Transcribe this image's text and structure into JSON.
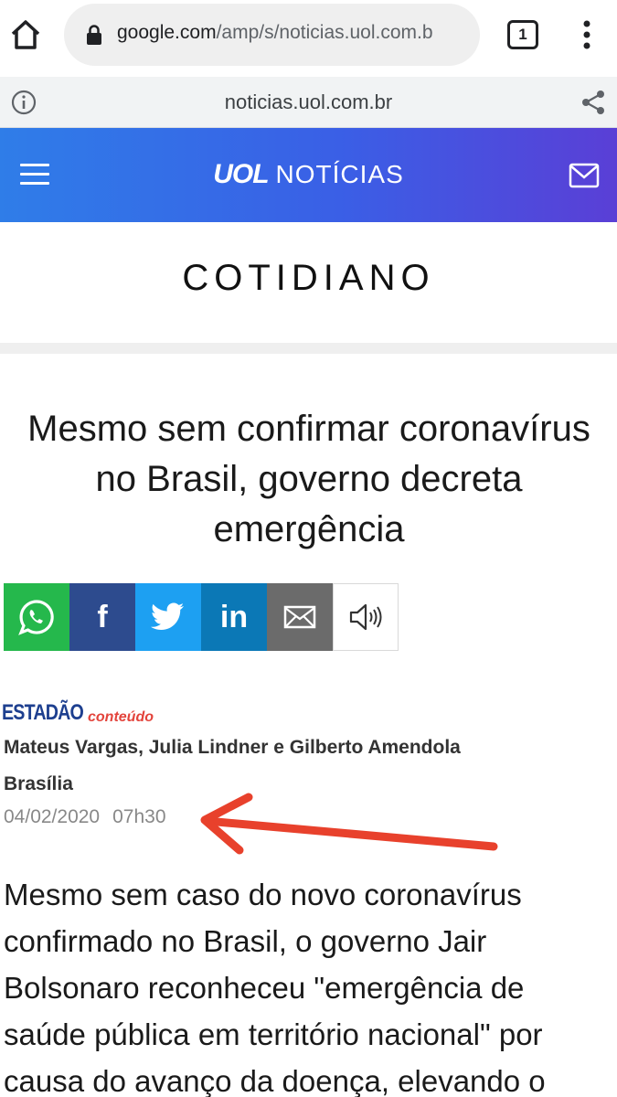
{
  "browser": {
    "url_host": "google.com",
    "url_path": "/amp/s/noticias.uol.com.b",
    "tab_count": "1",
    "icons": [
      "home-icon",
      "lock-icon",
      "overflow-menu-icon"
    ]
  },
  "amp_bar": {
    "domain": "noticias.uol.com.br",
    "icons": [
      "info-icon",
      "share-icon"
    ]
  },
  "header": {
    "logo": "UOL",
    "section": "NOTÍCIAS",
    "gradient": [
      "#2f7de8",
      "#5a3fd6"
    ],
    "icons": [
      "hamburger-menu-icon",
      "mail-icon"
    ]
  },
  "section_title": "COTIDIANO",
  "article": {
    "headline": "Mesmo sem confirmar coronavírus no Brasil, governo decreta emergência",
    "share_buttons": [
      {
        "name": "whatsapp",
        "icon": "whatsapp-icon",
        "color": "#25b84c"
      },
      {
        "name": "facebook",
        "icon": "facebook-icon",
        "label": "f",
        "color": "#2d4b8e"
      },
      {
        "name": "twitter",
        "icon": "twitter-icon",
        "color": "#1da0f2"
      },
      {
        "name": "linkedin",
        "icon": "linkedin-icon",
        "label": "in",
        "color": "#0b78b6"
      },
      {
        "name": "email",
        "icon": "email-icon",
        "color": "#6b6b6b"
      },
      {
        "name": "audio",
        "icon": "speaker-icon",
        "color": "#ffffff"
      }
    ],
    "source_brand": "ESTADÃO",
    "source_suffix": "conteúdo",
    "authors": "Mateus Vargas, Julia Lindner e Gilberto Amendola",
    "location": "Brasília",
    "date": "04/02/2020",
    "time": "07h30",
    "body": "Mesmo sem caso do novo coronavírus confirmado no Brasil, o governo Jair Bolsonaro reconheceu \"emergência de saúde pública em território nacional\" por causa do avanço da doença, elevando o"
  },
  "annotation": {
    "icon": "red-arrow-icon",
    "color": "#e8412c"
  }
}
